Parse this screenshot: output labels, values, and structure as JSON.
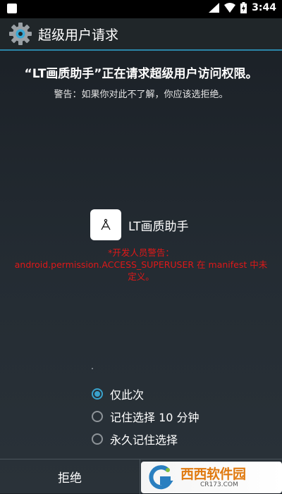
{
  "status_bar": {
    "time": "3:44"
  },
  "app_bar": {
    "title": "超级用户请求"
  },
  "request": {
    "headline": "“LT画质助手”正在请求超级用户访问权限。",
    "warning": "警告：如果你对此不了解，你应该选拒绝。"
  },
  "app": {
    "name": "LT画质助手",
    "icon": "compass-icon"
  },
  "developer_warning": {
    "line1": "*开发人员警告：",
    "line2": "android.permission.ACCESS_SUPERUSER 在 manifest 中未",
    "line3": "定义。"
  },
  "options": [
    {
      "label": "仅此次",
      "checked": true
    },
    {
      "label": "记住选择 10 分钟",
      "checked": false
    },
    {
      "label": "永久记住选择",
      "checked": false
    }
  ],
  "buttons": {
    "deny": "拒绝"
  },
  "watermark": {
    "brand": "西西软件园",
    "url": "CR173.COM"
  },
  "colors": {
    "accent": "#39a2cc",
    "warning_red": "#e01818",
    "appbar_line": "#2b86a8"
  }
}
